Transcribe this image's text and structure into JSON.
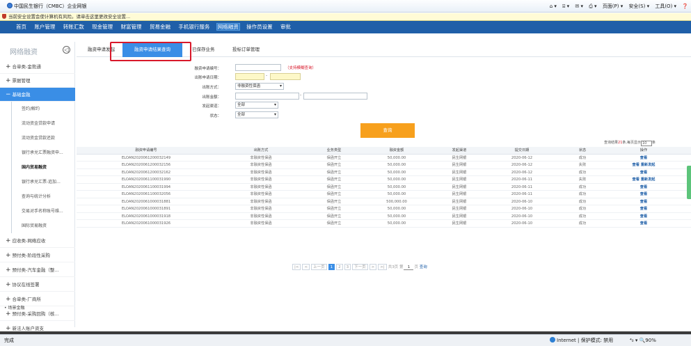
{
  "browser": {
    "tab_title": "中国民生银行（CMBC）企业网银",
    "tools": [
      "⌂ ▾",
      "⌸ ▾",
      "✉ ▾",
      "⎙ ▾",
      "页面(P) ▾",
      "安全(S) ▾",
      "工具(O) ▾",
      "❓"
    ],
    "security_bar": "当前安全设置会使计算机有风险。请单击这里更改安全设置...",
    "status_left": "完成",
    "status_zone": "Internet | 保护模式: 禁用",
    "status_zoom": "⁴₀ ▾   🔍90%"
  },
  "topnav": {
    "items": [
      "首页",
      "账户管理",
      "转账汇款",
      "现金管理",
      "财富管理",
      "贸易金融",
      "手机银行服务",
      "网络融资",
      "操作员设置",
      "审批"
    ],
    "active": "网络融资"
  },
  "sidebar": {
    "title": "网络融资",
    "toggle": "◁",
    "items": [
      {
        "label": "合单类-金熊通",
        "plus": "+"
      },
      {
        "label": "票据管理",
        "plus": "+"
      },
      {
        "label": "基础金融",
        "plus": "−",
        "active": true
      },
      {
        "label": "应收类-网络应收",
        "plus": "+"
      },
      {
        "label": "预付类-阶段性采购",
        "plus": "+"
      },
      {
        "label": "预付类-汽车金融（整...",
        "plus": "+"
      },
      {
        "label": "协议在线签署",
        "plus": "+"
      },
      {
        "label": "合单类-厂商所",
        "plus": "+"
      },
      {
        "label": "预付类-采购回购（核...",
        "plus": "+"
      },
      {
        "label": "新法人账户资支",
        "plus": "+"
      },
      {
        "label": "场景金融",
        "plus": "•"
      }
    ],
    "subitems": [
      "签约/解约",
      "流动资金贷款申请",
      "流动资金贷款还款",
      "银行承兑汇票融资申...",
      "国内贸易融资",
      "银行承兑汇票-追加...",
      "查询与统计分析",
      "交易对手名称账号维...",
      "国际贸易融资"
    ]
  },
  "content_tabs": [
    "融资申请发起",
    "融资申请结果查询",
    "已保存业务",
    "投标订单管理"
  ],
  "active_tab": "融资申请结果查询",
  "form": {
    "labels": [
      "融资申请编号：",
      "出账申请日期：",
      "出账方式：",
      "出账金额：",
      "发起渠道：",
      "状态："
    ],
    "hint": "（支持模糊查询）",
    "method_value": "非融资性保函",
    "channel_value": "全部",
    "status_value": "全部",
    "date_sep": "-",
    "amount_sep": "-"
  },
  "query_button": "查询",
  "results_info": {
    "prefix": "查询结果",
    "count": "21",
    "middle": "条,每页显示",
    "page_size": "10",
    "suffix": "条"
  },
  "table": {
    "headers": [
      "融资申请编号",
      "出账方式",
      "业务类型",
      "融资金额",
      "发起渠道",
      "提交日期",
      "状态",
      "操作"
    ],
    "rows": [
      {
        "id": "ELOAN2020061200032149",
        "method": "非融资性保函",
        "type": "保函开立",
        "amount": "50,000.00",
        "channel": "民生网银",
        "date": "2020-06-12",
        "status": "成功",
        "op": "查看"
      },
      {
        "id": "ELOAN2020061200032156",
        "method": "非融资性保函",
        "type": "保函开立",
        "amount": "50,000.00",
        "channel": "民生网银",
        "date": "2020-06-12",
        "status": "失败",
        "op": "查看 重新发起"
      },
      {
        "id": "ELOAN2020061200032162",
        "method": "非融资性保函",
        "type": "保函开立",
        "amount": "50,000.00",
        "channel": "民生网银",
        "date": "2020-06-12",
        "status": "成功",
        "op": "查看"
      },
      {
        "id": "ELOAN2020061100031990",
        "method": "非融资性保函",
        "type": "保函开立",
        "amount": "50,000.00",
        "channel": "民生网银",
        "date": "2020-06-11",
        "status": "失败",
        "op": "查看 重新发起"
      },
      {
        "id": "ELOAN2020061100031994",
        "method": "非融资性保函",
        "type": "保函开立",
        "amount": "50,000.00",
        "channel": "民生网银",
        "date": "2020-06-11",
        "status": "成功",
        "op": "查看"
      },
      {
        "id": "ELOAN2020061100032056",
        "method": "非融资性保函",
        "type": "保函开立",
        "amount": "50,000.00",
        "channel": "民生网银",
        "date": "2020-06-11",
        "status": "成功",
        "op": "查看"
      },
      {
        "id": "ELOAN2020061000031881",
        "method": "非融资性保函",
        "type": "保函开立",
        "amount": "500,000.00",
        "channel": "民生网银",
        "date": "2020-06-10",
        "status": "成功",
        "op": "查看"
      },
      {
        "id": "ELOAN2020061000031891",
        "method": "非融资性保函",
        "type": "保函开立",
        "amount": "50,000.00",
        "channel": "民生网银",
        "date": "2020-06-10",
        "status": "成功",
        "op": "查看"
      },
      {
        "id": "ELOAN2020061000031918",
        "method": "非融资性保函",
        "type": "保函开立",
        "amount": "50,000.00",
        "channel": "民生网银",
        "date": "2020-06-10",
        "status": "成功",
        "op": "查看"
      },
      {
        "id": "ELOAN2020061000031926",
        "method": "非融资性保函",
        "type": "保函开立",
        "amount": "50,000.00",
        "channel": "民生网银",
        "date": "2020-06-10",
        "status": "成功",
        "op": "查看"
      }
    ]
  },
  "pager": {
    "first": "|<",
    "prev_arrow": "<",
    "prev": "上一页",
    "pages": [
      "1",
      "2",
      "3"
    ],
    "current": "1",
    "next": "下一页",
    "next_arrow": ">",
    "last": ">|",
    "total": "共3页",
    "goto_prefix": "第",
    "goto_value": "1",
    "goto_suffix": "页",
    "goto_button": "查询"
  },
  "colors": {
    "nav_blue": "#1f5fa8",
    "accent_blue": "#3a8ee6",
    "query_orange": "#f7a01d",
    "highlight_red": "#d8182a"
  }
}
